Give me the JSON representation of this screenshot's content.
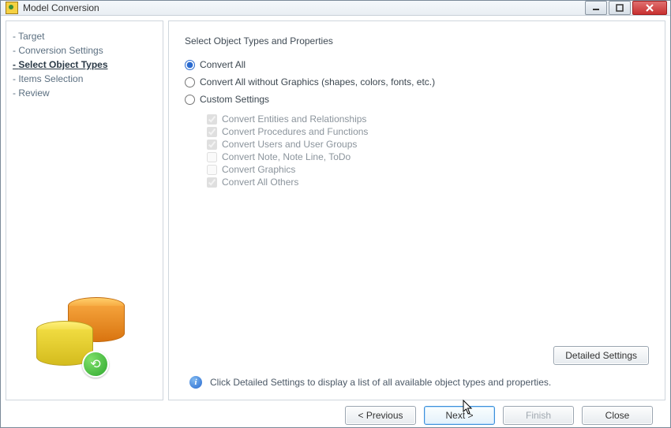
{
  "window": {
    "title": "Model Conversion"
  },
  "sidebar": {
    "items": [
      {
        "label": "Target",
        "active": false
      },
      {
        "label": "Conversion Settings",
        "active": false
      },
      {
        "label": "Select Object Types",
        "active": true
      },
      {
        "label": "Items Selection",
        "active": false
      },
      {
        "label": "Review",
        "active": false
      }
    ]
  },
  "main": {
    "section_title": "Select Object Types and Properties",
    "radios": {
      "convert_all": "Convert All",
      "convert_all_no_graphics": "Convert All without Graphics (shapes, colors, fonts, etc.)",
      "custom": "Custom Settings"
    },
    "checks": [
      {
        "label": "Convert Entities and Relationships",
        "checked": true
      },
      {
        "label": "Convert Procedures and Functions",
        "checked": true
      },
      {
        "label": "Convert Users and User Groups",
        "checked": true
      },
      {
        "label": "Convert Note, Note Line, ToDo",
        "checked": false
      },
      {
        "label": "Convert Graphics",
        "checked": false
      },
      {
        "label": "Convert All Others",
        "checked": true
      }
    ],
    "detailed_button": "Detailed Settings",
    "info_text": "Click Detailed Settings to display a list of all available object types and properties."
  },
  "footer": {
    "previous": "< Previous",
    "next": "Next >",
    "finish": "Finish",
    "close": "Close"
  }
}
